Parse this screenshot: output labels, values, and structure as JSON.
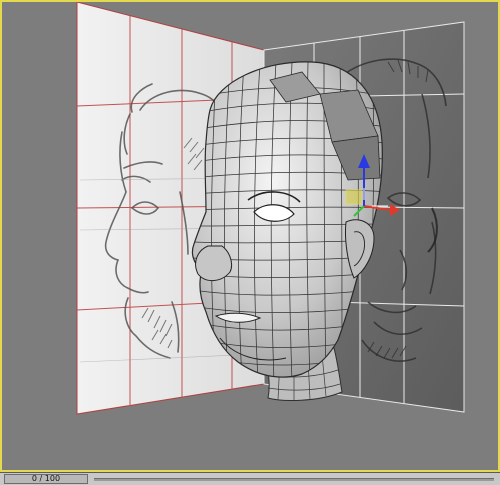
{
  "viewport": {
    "border_color": "#e3d94f",
    "background": "#7d7d7d",
    "objects": [
      "side-reference-plane",
      "front-reference-plane",
      "head-mesh",
      "move-gizmo"
    ]
  },
  "gizmo": {
    "x_axis_color": "#e23a2a",
    "y_axis_color": "#38c23a",
    "z_axis_color": "#2a3ae2"
  },
  "timeline": {
    "frame_counter": "0 / 100"
  }
}
